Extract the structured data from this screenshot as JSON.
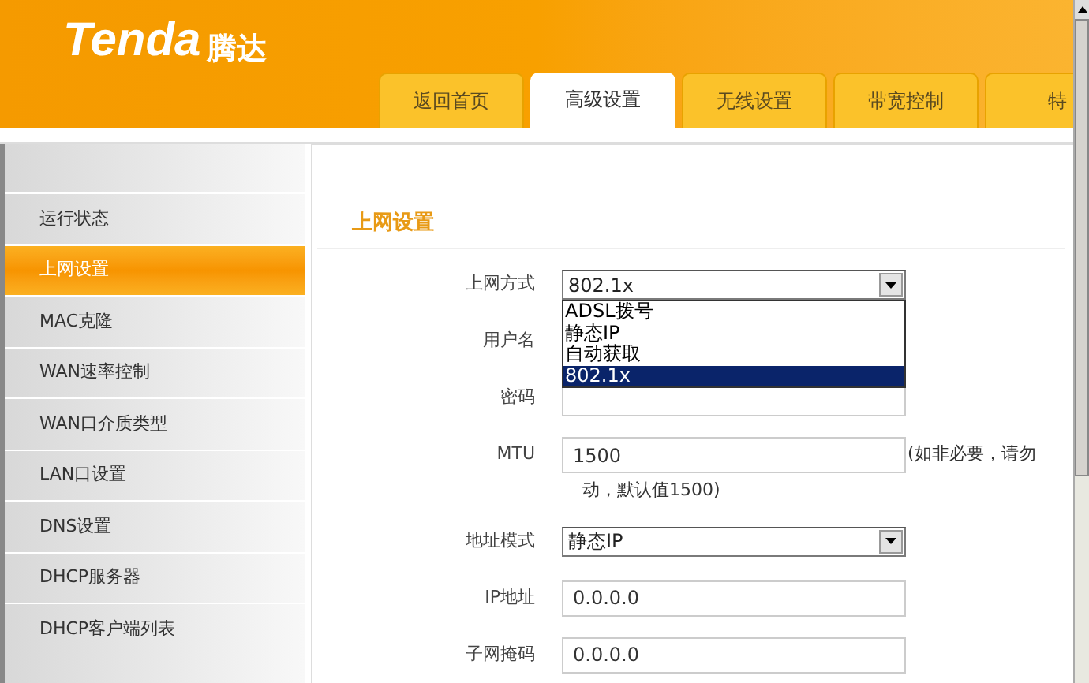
{
  "logo": {
    "brand": "Tenda",
    "brand_cn": "腾达"
  },
  "tabs": [
    {
      "label": "返回首页",
      "selected": false
    },
    {
      "label": "高级设置",
      "selected": true
    },
    {
      "label": "无线设置",
      "selected": false
    },
    {
      "label": "带宽控制",
      "selected": false
    },
    {
      "label": "特",
      "selected": false
    }
  ],
  "sidebar": {
    "items": [
      {
        "label": "运行状态",
        "selected": false
      },
      {
        "label": "上网设置",
        "selected": true
      },
      {
        "label": "MAC克隆",
        "selected": false
      },
      {
        "label": "WAN速率控制",
        "selected": false
      },
      {
        "label": "WAN口介质类型",
        "selected": false
      },
      {
        "label": "LAN口设置",
        "selected": false
      },
      {
        "label": "DNS设置",
        "selected": false
      },
      {
        "label": "DHCP服务器",
        "selected": false
      },
      {
        "label": "DHCP客户端列表",
        "selected": false
      }
    ]
  },
  "form": {
    "title": "上网设置",
    "rows": [
      {
        "kind": "select",
        "label": "上网方式",
        "value": "802.1x",
        "options": [
          {
            "label": "ADSL拨号",
            "selected": false
          },
          {
            "label": "静态IP",
            "selected": false
          },
          {
            "label": "自动获取",
            "selected": false
          },
          {
            "label": "802.1x",
            "selected": true
          }
        ]
      },
      {
        "kind": "text",
        "label": "用户名"
      },
      {
        "kind": "text",
        "label": "密码"
      },
      {
        "kind": "text",
        "label": "MTU",
        "value": "1500",
        "hint": "(如非必要，请勿",
        "hint_cont": "动，默认值1500)"
      },
      {
        "kind": "select",
        "label": "地址模式",
        "value": "静态IP"
      },
      {
        "kind": "text",
        "label": "IP地址",
        "value": "0.0.0.0"
      },
      {
        "kind": "text",
        "label": "子网掩码",
        "value": "0.0.0.0"
      }
    ]
  }
}
